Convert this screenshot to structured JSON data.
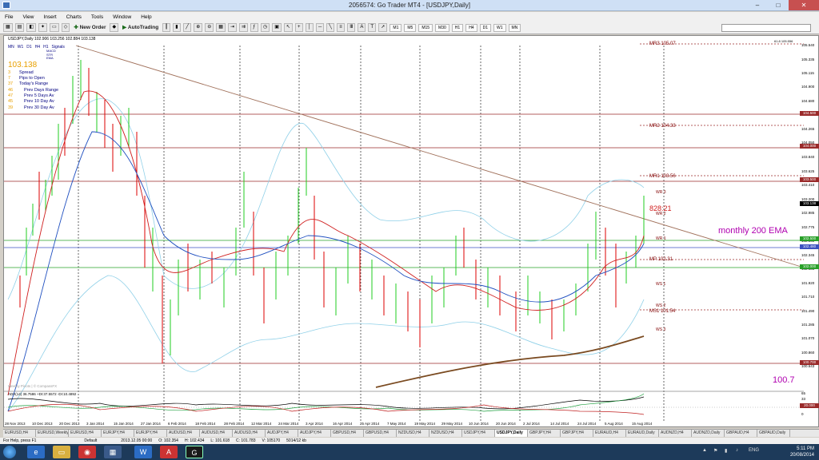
{
  "window": {
    "title": "2056574: Go Trader MT4 - [USDJPY,Daily]",
    "buttons": {
      "minimize": "–",
      "maximize": "□",
      "close": "✕"
    }
  },
  "menu": [
    "File",
    "View",
    "Insert",
    "Charts",
    "Tools",
    "Window",
    "Help"
  ],
  "toolbar": {
    "new_order": "New Order",
    "autotrading": "AutoTrading",
    "timeframes": [
      "M1",
      "M5",
      "M15",
      "M30",
      "H1",
      "H4",
      "D1",
      "W1",
      "MN"
    ]
  },
  "chart": {
    "symbol_line": "USDJPY,Daily  102.906 103.256 102.884 103.138",
    "signal_panel": {
      "timeframes": [
        "MN",
        "W1",
        "D1",
        "H4",
        "H1"
      ],
      "signals_label": "Signals",
      "signal_names": [
        "MACD",
        "STR",
        "EMA"
      ],
      "price": "103.138",
      "rows": [
        {
          "value": "3",
          "label": "Spread"
        },
        {
          "value": "7",
          "label": "Pips to Open"
        },
        {
          "value": "37",
          "label": "Today's Range"
        },
        {
          "value": "46",
          "label": "Prev Days Range"
        },
        {
          "value": "47",
          "label": "Prev 5 Days Av"
        },
        {
          "value": "45",
          "label": "Prev 10 Day Av"
        },
        {
          "value": "39",
          "label": "Prev 30 Day Av"
        }
      ]
    },
    "price_axis": [
      "105.540",
      "105.335",
      "105.115",
      "104.900",
      "104.680",
      "104.265",
      "104.050",
      "103.840",
      "103.625",
      "103.410",
      "103.200",
      "102.985",
      "102.775",
      "102.560",
      "102.345",
      "102.135",
      "101.920",
      "101.710",
      "101.490",
      "101.285",
      "101.070",
      "100.860",
      "100.643"
    ],
    "levels": {
      "mr3": "MR3  105.07",
      "mr2": "MR2  104.33",
      "mr1": "MR1  103.56",
      "mp": "MP   102.31",
      "ms1": "MS1  101.54",
      "wr3": "WR 3",
      "wr2": "WR 2",
      "wr1": "WR 1",
      "ws1": "WS 1",
      "ws2": "WS 2",
      "ws3": "WS 3",
      "fib": "61.8  105.556",
      "timer": "828:21",
      "ema_label": "monthly 200 EMA",
      "level_100": "100.7",
      "watermark": "Weekly Pivots | © CompassFX"
    },
    "price_tags": [
      "104.500",
      "104.000",
      "103.500",
      "103.138",
      "102.500",
      "102.480",
      "102.000",
      "100.700"
    ],
    "adx_header": "ADX(14) 36.7586 +DI:37.5572 -DI:10.4892",
    "adx_axis": [
      "65",
      "33",
      "20.000",
      "0"
    ],
    "dates": [
      "28 Nov 2013",
      "10 Dec 2013",
      "20 Dec 2013",
      "3 Jan 2014",
      "15 Jan 2014",
      "27 Jan 2014",
      "6 Feb 2014",
      "18 Feb 2014",
      "28 Feb 2014",
      "12 Mar 2014",
      "24 Mar 2014",
      "3 Apr 2014",
      "16 Apr 2014",
      "25 Apr 2014",
      "7 May 2014",
      "19 May 2014",
      "29 May 2014",
      "10 Jun 2014",
      "20 Jun 2014",
      "2 Jul 2014",
      "14 Jul 2014",
      "24 Jul 2014",
      "5 Aug 2014",
      "15 Aug 2014"
    ]
  },
  "tabs": [
    "EURUSD,H4",
    "EURUSD,Weekly",
    "EURUSD,H4",
    "EURJPY,H4",
    "EURJPY,H4",
    "AUDUSD,H4",
    "AUDUSD,H4",
    "AUDUSD,H4",
    "AUDJPY,H4",
    "AUDJPY,H4",
    "GBPUSD,H4",
    "GBPUSD,H4",
    "NZDUSD,H4",
    "NZDUSD,H4",
    "USDJPY,H4",
    "USDJPY,Daily",
    "GBPJPY,H4",
    "GBPJPY,H4",
    "EURAUD,H4",
    "EURAUD,Daily",
    "AUDNZD,H4",
    "AUDNZD,Daily",
    "GBPAUD,H4",
    "GBPAUD,Daily"
  ],
  "active_tab": 15,
  "status": {
    "help": "For Help, press F1",
    "profile": "Default",
    "time": "2013.12.05 00:00",
    "o": "O: 102.354",
    "h": "H: 102.434",
    "l": "L: 101.618",
    "c": "C: 101.783",
    "v": "V: 105170",
    "mem": "5014/12 kb"
  },
  "taskbar": {
    "lang": "ENG",
    "time": "5:11 PM",
    "date": "20/08/2014"
  }
}
